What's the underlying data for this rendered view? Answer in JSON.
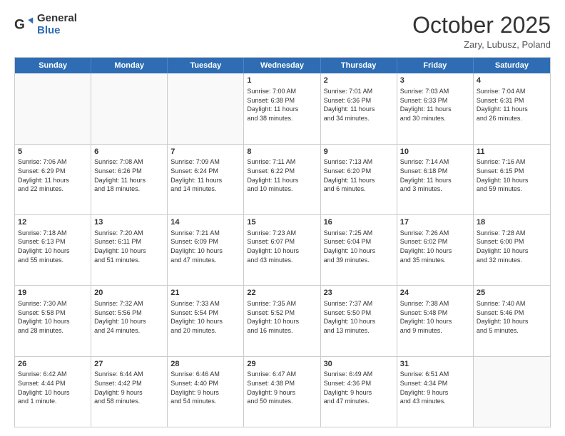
{
  "logo": {
    "general": "General",
    "blue": "Blue"
  },
  "header": {
    "month": "October 2025",
    "location": "Zary, Lubusz, Poland"
  },
  "weekdays": [
    "Sunday",
    "Monday",
    "Tuesday",
    "Wednesday",
    "Thursday",
    "Friday",
    "Saturday"
  ],
  "rows": [
    [
      {
        "day": "",
        "text": ""
      },
      {
        "day": "",
        "text": ""
      },
      {
        "day": "",
        "text": ""
      },
      {
        "day": "1",
        "text": "Sunrise: 7:00 AM\nSunset: 6:38 PM\nDaylight: 11 hours\nand 38 minutes."
      },
      {
        "day": "2",
        "text": "Sunrise: 7:01 AM\nSunset: 6:36 PM\nDaylight: 11 hours\nand 34 minutes."
      },
      {
        "day": "3",
        "text": "Sunrise: 7:03 AM\nSunset: 6:33 PM\nDaylight: 11 hours\nand 30 minutes."
      },
      {
        "day": "4",
        "text": "Sunrise: 7:04 AM\nSunset: 6:31 PM\nDaylight: 11 hours\nand 26 minutes."
      }
    ],
    [
      {
        "day": "5",
        "text": "Sunrise: 7:06 AM\nSunset: 6:29 PM\nDaylight: 11 hours\nand 22 minutes."
      },
      {
        "day": "6",
        "text": "Sunrise: 7:08 AM\nSunset: 6:26 PM\nDaylight: 11 hours\nand 18 minutes."
      },
      {
        "day": "7",
        "text": "Sunrise: 7:09 AM\nSunset: 6:24 PM\nDaylight: 11 hours\nand 14 minutes."
      },
      {
        "day": "8",
        "text": "Sunrise: 7:11 AM\nSunset: 6:22 PM\nDaylight: 11 hours\nand 10 minutes."
      },
      {
        "day": "9",
        "text": "Sunrise: 7:13 AM\nSunset: 6:20 PM\nDaylight: 11 hours\nand 6 minutes."
      },
      {
        "day": "10",
        "text": "Sunrise: 7:14 AM\nSunset: 6:18 PM\nDaylight: 11 hours\nand 3 minutes."
      },
      {
        "day": "11",
        "text": "Sunrise: 7:16 AM\nSunset: 6:15 PM\nDaylight: 10 hours\nand 59 minutes."
      }
    ],
    [
      {
        "day": "12",
        "text": "Sunrise: 7:18 AM\nSunset: 6:13 PM\nDaylight: 10 hours\nand 55 minutes."
      },
      {
        "day": "13",
        "text": "Sunrise: 7:20 AM\nSunset: 6:11 PM\nDaylight: 10 hours\nand 51 minutes."
      },
      {
        "day": "14",
        "text": "Sunrise: 7:21 AM\nSunset: 6:09 PM\nDaylight: 10 hours\nand 47 minutes."
      },
      {
        "day": "15",
        "text": "Sunrise: 7:23 AM\nSunset: 6:07 PM\nDaylight: 10 hours\nand 43 minutes."
      },
      {
        "day": "16",
        "text": "Sunrise: 7:25 AM\nSunset: 6:04 PM\nDaylight: 10 hours\nand 39 minutes."
      },
      {
        "day": "17",
        "text": "Sunrise: 7:26 AM\nSunset: 6:02 PM\nDaylight: 10 hours\nand 35 minutes."
      },
      {
        "day": "18",
        "text": "Sunrise: 7:28 AM\nSunset: 6:00 PM\nDaylight: 10 hours\nand 32 minutes."
      }
    ],
    [
      {
        "day": "19",
        "text": "Sunrise: 7:30 AM\nSunset: 5:58 PM\nDaylight: 10 hours\nand 28 minutes."
      },
      {
        "day": "20",
        "text": "Sunrise: 7:32 AM\nSunset: 5:56 PM\nDaylight: 10 hours\nand 24 minutes."
      },
      {
        "day": "21",
        "text": "Sunrise: 7:33 AM\nSunset: 5:54 PM\nDaylight: 10 hours\nand 20 minutes."
      },
      {
        "day": "22",
        "text": "Sunrise: 7:35 AM\nSunset: 5:52 PM\nDaylight: 10 hours\nand 16 minutes."
      },
      {
        "day": "23",
        "text": "Sunrise: 7:37 AM\nSunset: 5:50 PM\nDaylight: 10 hours\nand 13 minutes."
      },
      {
        "day": "24",
        "text": "Sunrise: 7:38 AM\nSunset: 5:48 PM\nDaylight: 10 hours\nand 9 minutes."
      },
      {
        "day": "25",
        "text": "Sunrise: 7:40 AM\nSunset: 5:46 PM\nDaylight: 10 hours\nand 5 minutes."
      }
    ],
    [
      {
        "day": "26",
        "text": "Sunrise: 6:42 AM\nSunset: 4:44 PM\nDaylight: 10 hours\nand 1 minute."
      },
      {
        "day": "27",
        "text": "Sunrise: 6:44 AM\nSunset: 4:42 PM\nDaylight: 9 hours\nand 58 minutes."
      },
      {
        "day": "28",
        "text": "Sunrise: 6:46 AM\nSunset: 4:40 PM\nDaylight: 9 hours\nand 54 minutes."
      },
      {
        "day": "29",
        "text": "Sunrise: 6:47 AM\nSunset: 4:38 PM\nDaylight: 9 hours\nand 50 minutes."
      },
      {
        "day": "30",
        "text": "Sunrise: 6:49 AM\nSunset: 4:36 PM\nDaylight: 9 hours\nand 47 minutes."
      },
      {
        "day": "31",
        "text": "Sunrise: 6:51 AM\nSunset: 4:34 PM\nDaylight: 9 hours\nand 43 minutes."
      },
      {
        "day": "",
        "text": ""
      }
    ]
  ]
}
